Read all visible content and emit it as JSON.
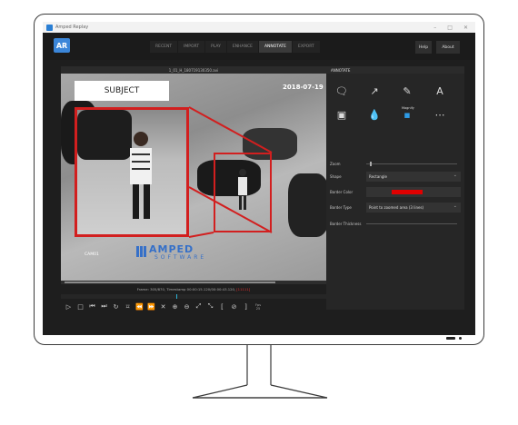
{
  "window": {
    "title": "Amped Replay"
  },
  "nav": {
    "logo": "AR",
    "tabs": [
      {
        "label": "RECENT",
        "active": false
      },
      {
        "label": "IMPORT",
        "active": false
      },
      {
        "label": "PLAY",
        "active": false
      },
      {
        "label": "ENHANCE",
        "active": false
      },
      {
        "label": "ANNOTATE",
        "active": true
      },
      {
        "label": "EXPORT",
        "active": false
      }
    ],
    "help": "Help",
    "about": "About"
  },
  "video": {
    "filename": "1_01_H_180719130350.avi",
    "subject_label": "SUBJECT",
    "timestamp": "2018-07-19",
    "camera": "CAM01",
    "brand_top": "AMPED",
    "brand_bottom": "SOFTWARE",
    "frame_info": "Frame: 305/870, Timestamp 00:00:15.120/00:00:43.120,",
    "frame_info_red": "[11111]",
    "fps_label": "Fps",
    "fps_value": "25"
  },
  "annotate": {
    "title": "ANNOTATE",
    "magnify_label": "Magnify",
    "props": {
      "zoom_label": "Zoom",
      "shape_label": "Shape",
      "shape_value": "Rectangle",
      "border_color_label": "Border Color",
      "border_color": "#e00000",
      "border_type_label": "Border Type",
      "border_type_value": "Point to zoomed area (3 lines)",
      "border_thickness_label": "Border Thickness"
    }
  }
}
